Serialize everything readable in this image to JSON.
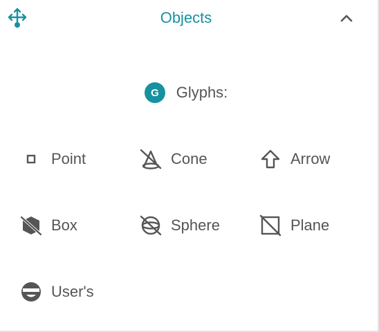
{
  "panel": {
    "title": "Objects",
    "header_icon": "move-arrows-icon",
    "collapse_icon": "chevron-up-icon",
    "accent_color": "#17919f"
  },
  "glyphs": {
    "badge_letter": "G",
    "label": "Glyphs:"
  },
  "options": [
    {
      "label": "Point",
      "icon": "point-icon"
    },
    {
      "label": "Cone",
      "icon": "cone-off-icon"
    },
    {
      "label": "Arrow",
      "icon": "arrow-up-outline-icon"
    },
    {
      "label": "Box",
      "icon": "cube-off-icon"
    },
    {
      "label": "Sphere",
      "icon": "sphere-off-icon"
    },
    {
      "label": "Plane",
      "icon": "square-off-icon"
    },
    {
      "label": "User's",
      "icon": "user-glyph-icon"
    }
  ]
}
